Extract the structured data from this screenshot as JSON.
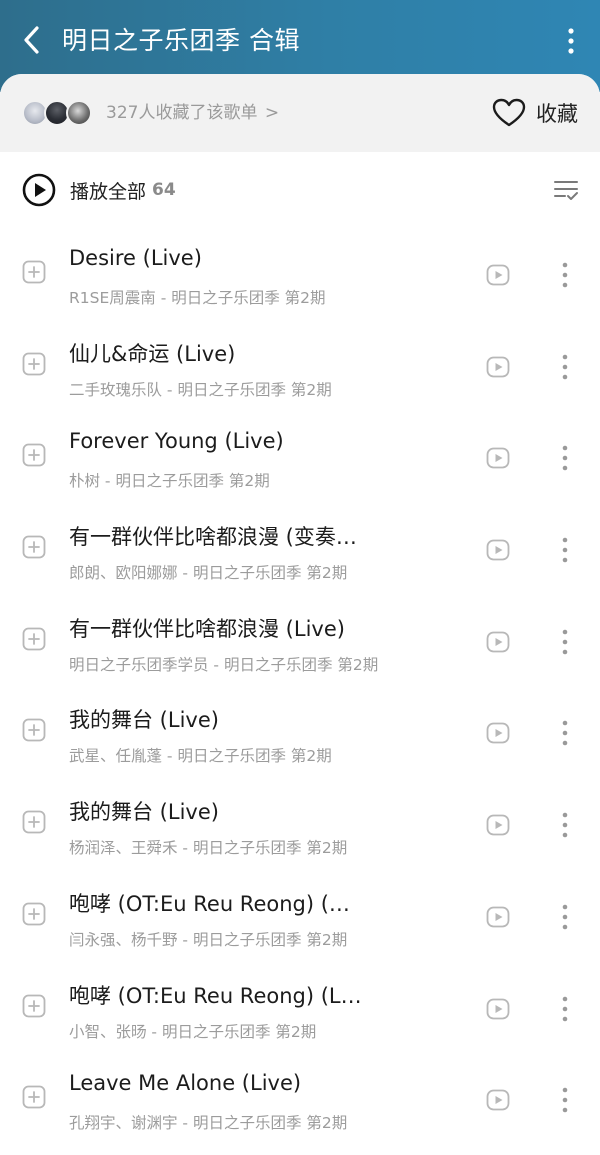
{
  "header": {
    "back_icon": "chevron-left-icon",
    "title": "明日之子乐团季 合辑",
    "more_icon": "more-vertical-icon"
  },
  "favorites": {
    "count_text": "327人收藏了该歌单",
    "chevron": ">",
    "button_label": "收藏",
    "button_icon": "heart-outline-icon"
  },
  "play_all": {
    "label": "播放全部",
    "count": "64",
    "icon": "play-circle-icon",
    "sort_icon": "list-sort-icon"
  },
  "songs": [
    {
      "title": "Desire (Live)",
      "subtitle": "R1SE周震南 - 明日之子乐团季 第2期"
    },
    {
      "title": "仙儿&命运 (Live)",
      "subtitle": "二手玫瑰乐队 - 明日之子乐团季 第2期"
    },
    {
      "title": "Forever Young (Live)",
      "subtitle": "朴树 - 明日之子乐团季 第2期"
    },
    {
      "title": "有一群伙伴比啥都浪漫 (变奏…",
      "subtitle": "郎朗、欧阳娜娜 - 明日之子乐团季 第2期"
    },
    {
      "title": "有一群伙伴比啥都浪漫 (Live)",
      "subtitle": "明日之子乐团季学员 - 明日之子乐团季 第2期"
    },
    {
      "title": "我的舞台 (Live)",
      "subtitle": "武星、任胤蓬 - 明日之子乐团季 第2期"
    },
    {
      "title": "我的舞台 (Live)",
      "subtitle": "杨润泽、王舜禾 - 明日之子乐团季 第2期"
    },
    {
      "title": "咆哮 (OT:Eu Reu Reong) (…",
      "subtitle": "闫永强、杨千野 - 明日之子乐团季 第2期"
    },
    {
      "title": "咆哮 (OT:Eu Reu Reong) (L…",
      "subtitle": "小智、张旸 - 明日之子乐团季 第2期"
    },
    {
      "title": "Leave Me Alone (Live)",
      "subtitle": "孔翔宇、谢渊宇 - 明日之子乐团季 第2期"
    }
  ],
  "colors": {
    "header_gradient_start": "#2e6e8c",
    "header_gradient_end": "#2f86b4",
    "icon_gray": "#b8b8b8",
    "subtitle_gray": "#9c9c9c"
  }
}
